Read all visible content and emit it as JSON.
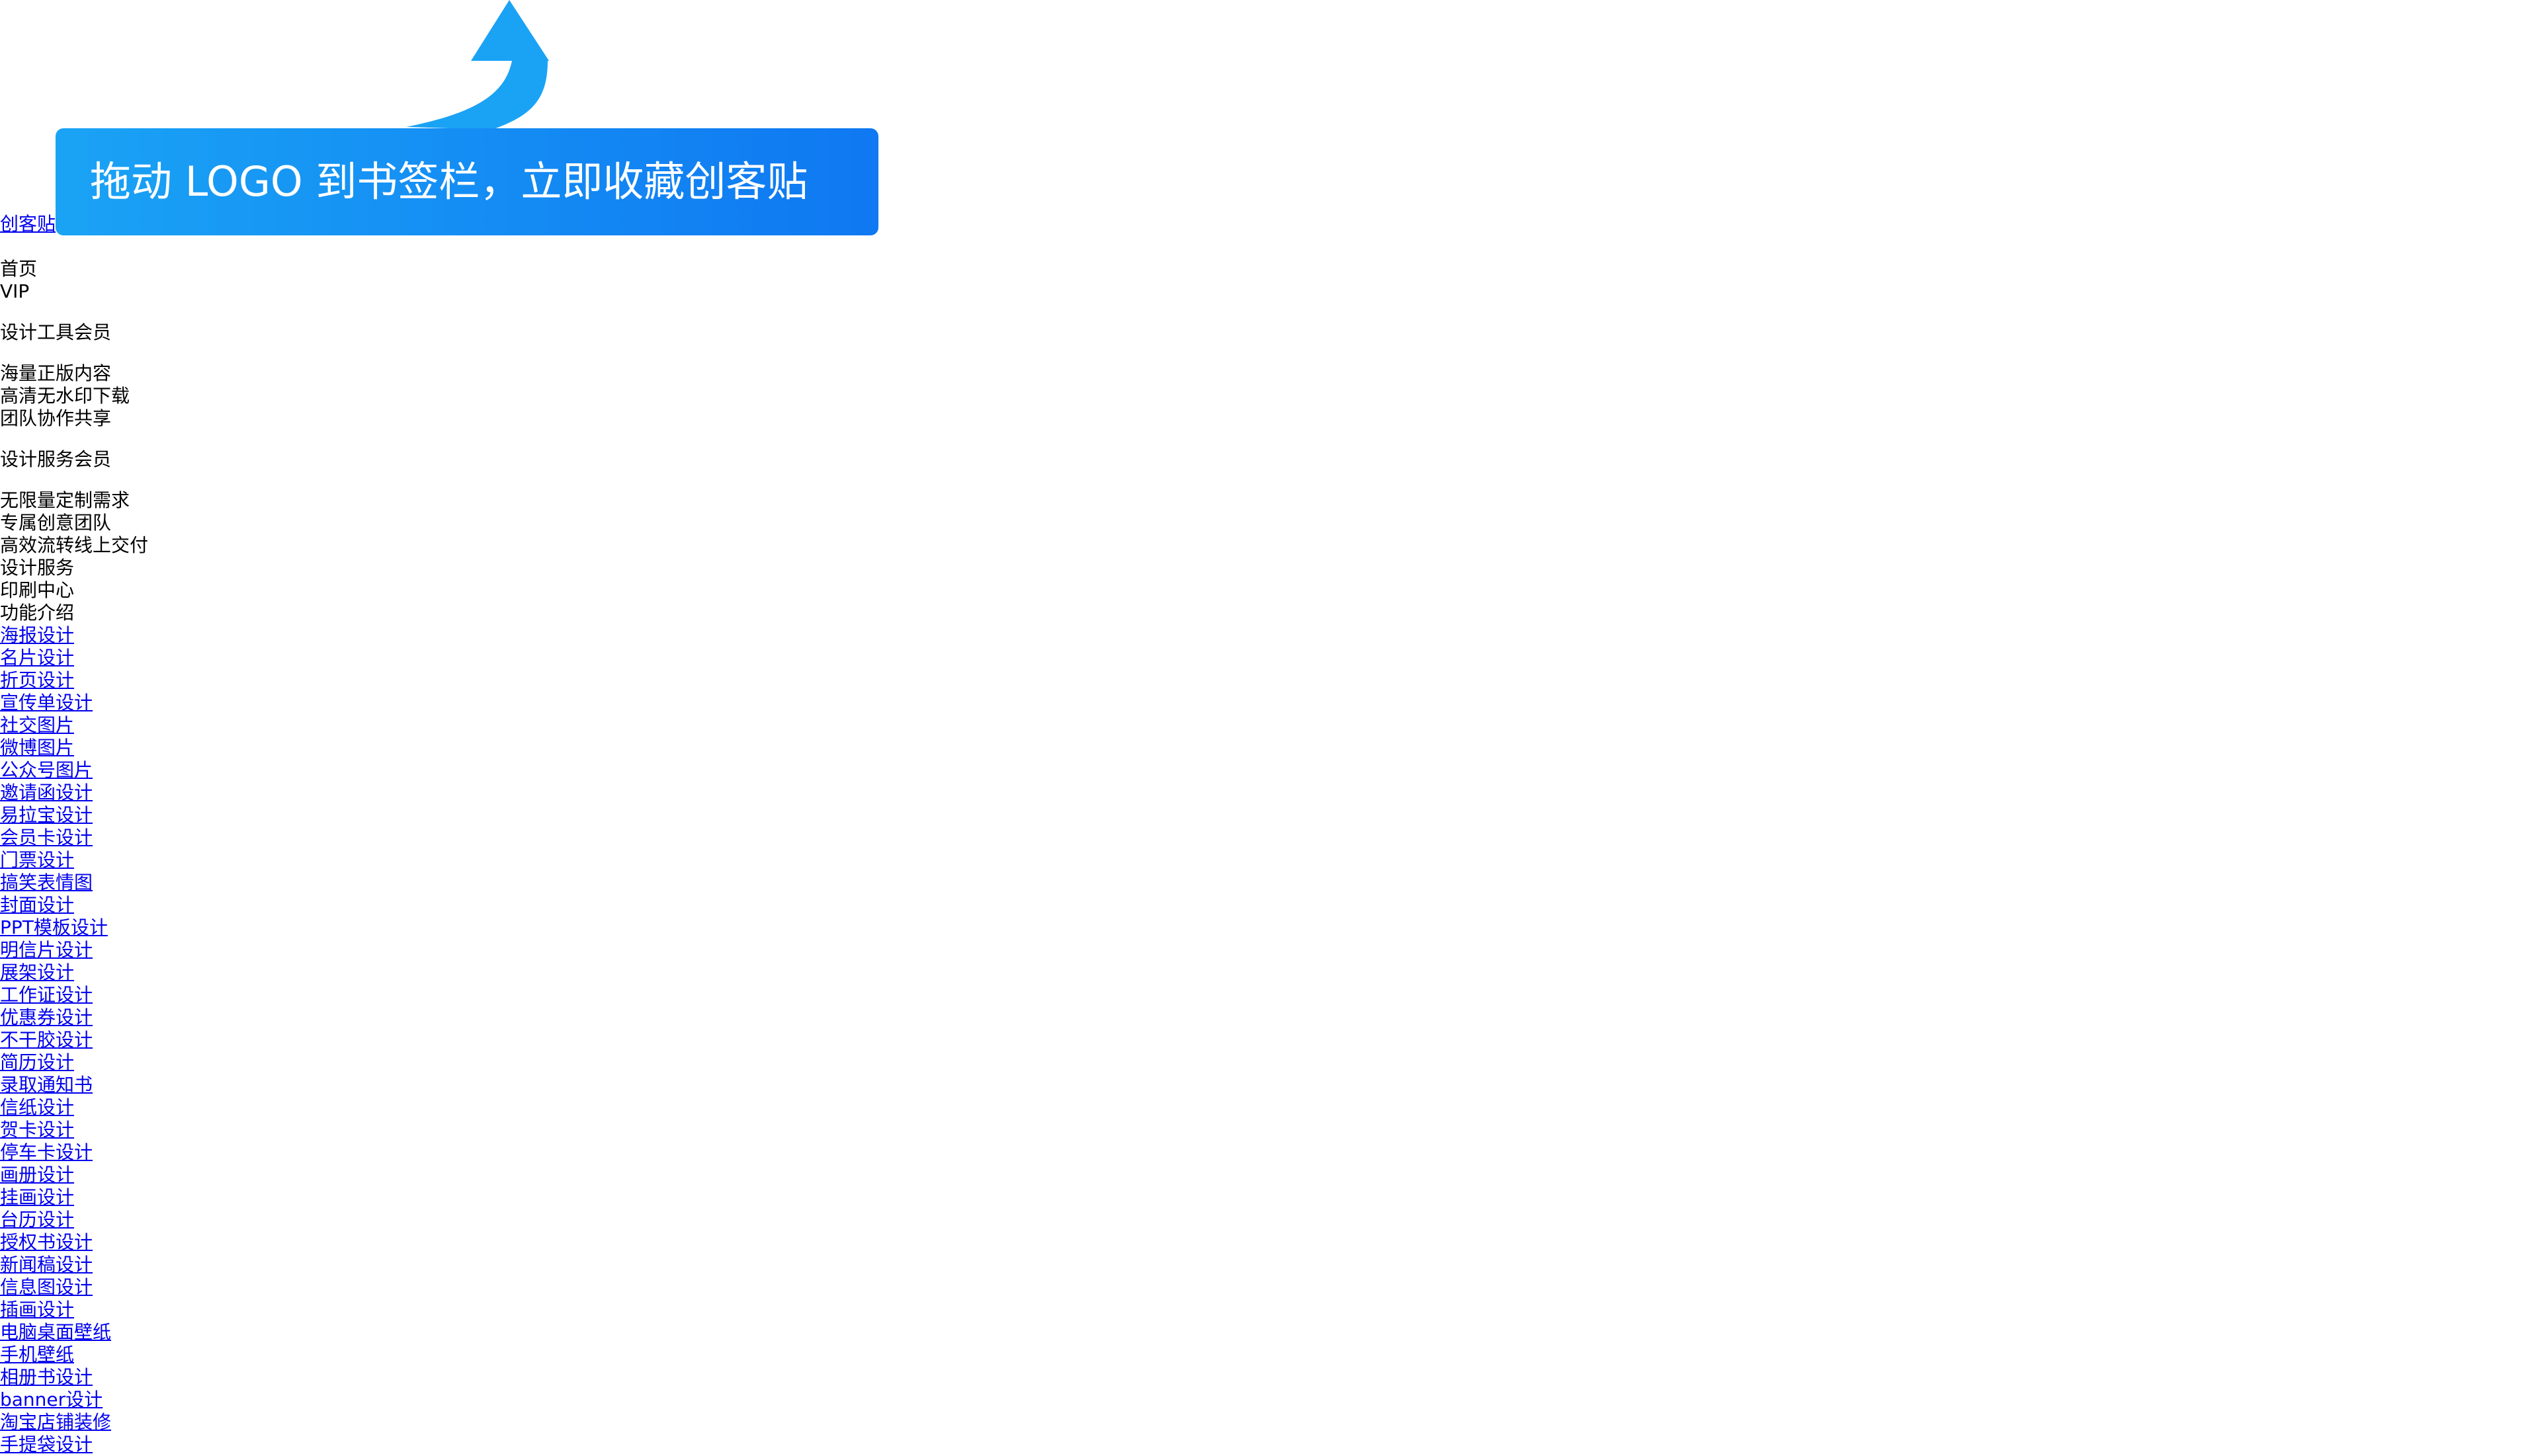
{
  "tooltip": {
    "text": "拖动 LOGO 到书签栏，立即收藏创客贴"
  },
  "logo": {
    "label": "创客贴"
  },
  "nav": {
    "home": "首页",
    "vip": "VIP"
  },
  "membership": {
    "tool_title": "设计工具会员",
    "tool_features": [
      "海量正版内容",
      "高清无水印下载",
      "团队协作共享"
    ],
    "service_title": "设计服务会员",
    "service_features": [
      "无限量定制需求",
      "专属创意团队",
      "高效流转线上交付"
    ]
  },
  "menu": {
    "design_service": "设计服务",
    "print_center": "印刷中心",
    "features_intro": "功能介绍"
  },
  "links": [
    "海报设计",
    "名片设计",
    "折页设计",
    "宣传单设计",
    "社交图片",
    "微博图片",
    "公众号图片",
    "邀请函设计",
    "易拉宝设计",
    "会员卡设计",
    "门票设计",
    "搞笑表情图",
    "封面设计",
    "PPT模板设计",
    "明信片设计",
    "展架设计",
    "工作证设计",
    "优惠券设计",
    "不干胶设计",
    "简历设计",
    "录取通知书",
    "信纸设计",
    "贺卡设计",
    "停车卡设计",
    "画册设计",
    "挂画设计",
    "台历设计",
    "授权书设计",
    "新闻稿设计",
    "信息图设计",
    "插画设计",
    "电脑桌面壁纸",
    "手机壁纸",
    "相册书设计",
    "banner设计",
    "淘宝店铺装修",
    "手提袋设计"
  ]
}
